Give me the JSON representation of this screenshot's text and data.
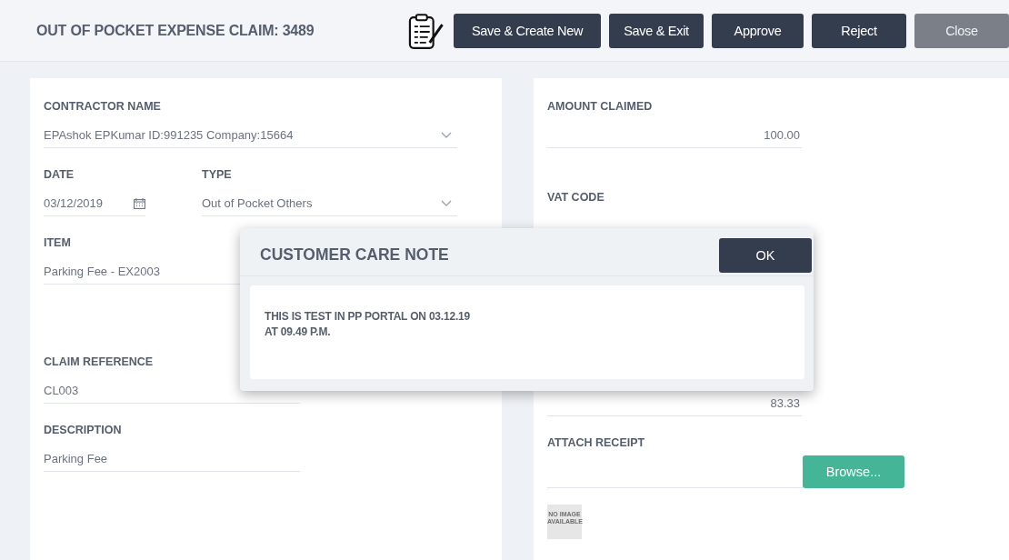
{
  "header": {
    "title": "OUT OF POCKET EXPENSE CLAIM: 3489"
  },
  "buttons": [
    {
      "label": "Save & Create New",
      "disabled": false
    },
    {
      "label": "Save & Exit",
      "disabled": false
    },
    {
      "label": "Approve",
      "disabled": false
    },
    {
      "label": "Reject",
      "disabled": false
    },
    {
      "label": "Close",
      "disabled": true
    }
  ],
  "left_form": {
    "contractor_name": {
      "label": "CONTRACTOR NAME",
      "value": "EPAshok EPKumar ID:991235 Company:15664"
    },
    "date": {
      "label": "DATE",
      "value": "03/12/2019"
    },
    "type": {
      "label": "TYPE",
      "value": "Out of Pocket Others"
    },
    "item": {
      "label": "ITEM",
      "value": "Parking Fee - EX2003"
    },
    "claim_reference": {
      "label": "CLAIM REFERENCE",
      "value": "CL003"
    },
    "description": {
      "label": "DESCRIPTION",
      "value": "Parking Fee"
    }
  },
  "right_form": {
    "amount_claimed": {
      "label": "AMOUNT CLAIMED",
      "value": "100.00"
    },
    "vat_code": {
      "label": "VAT CODE"
    },
    "net_amount": {
      "value": "83.33"
    },
    "attach_receipt": {
      "label": "ATTACH RECEIPT",
      "button": "Browse...",
      "no_image": "NO IMAGE AVAILABLE"
    }
  },
  "dialog": {
    "title": "CUSTOMER CARE NOTE",
    "ok_button": "OK",
    "message_lines": [
      "THIS IS TEST IN PP PORTAL ON 03.12.19",
      "AT 09.49 P.M."
    ]
  }
}
